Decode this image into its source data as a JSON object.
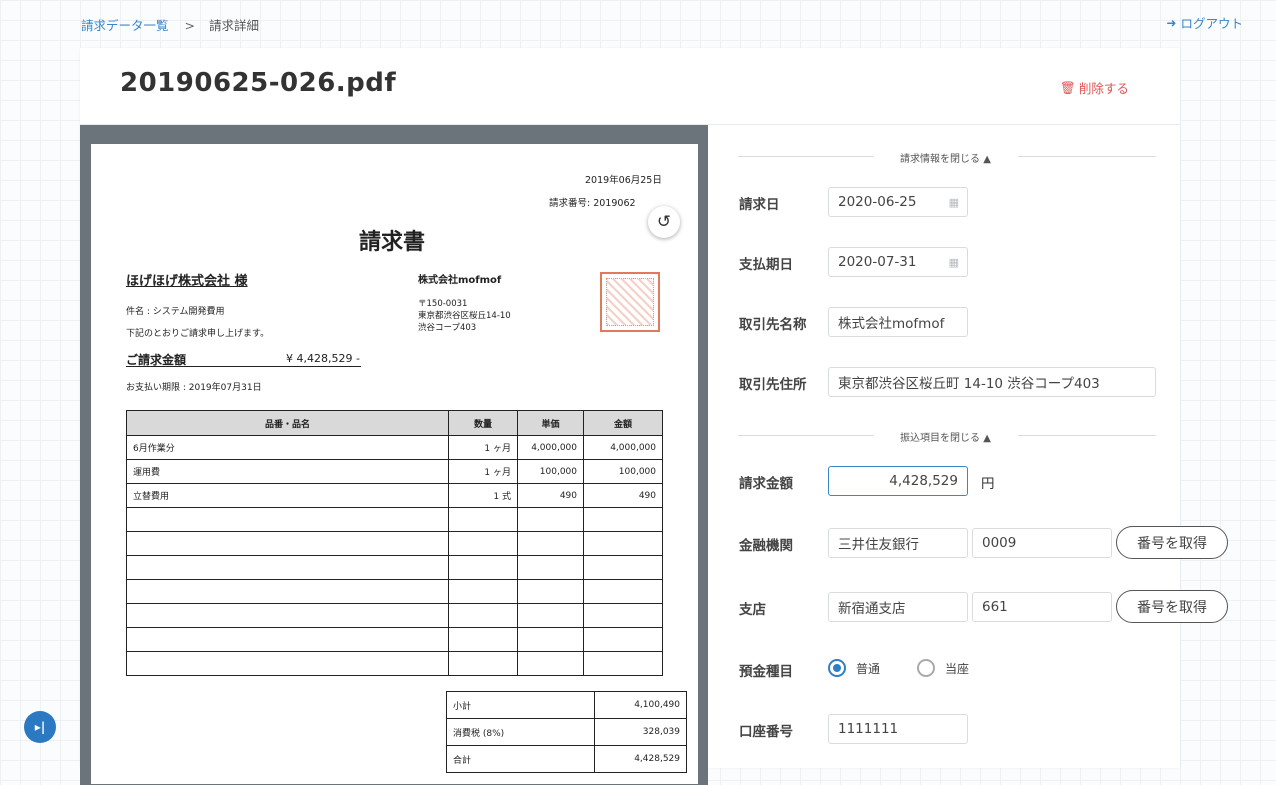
{
  "breadcrumb": {
    "home": "請求データ一覧",
    "separator": ">",
    "current": "請求詳細"
  },
  "header": {
    "logout_icon": "logout-icon",
    "logout_label": "ログアウト"
  },
  "card": {
    "file_title": "20190625-026.pdf",
    "delete_icon": "trash-icon",
    "delete_label": "削除する"
  },
  "document": {
    "date": "2019年06月25日",
    "invoice_no": "請求番号: 2019062",
    "title": "請求書",
    "client": "ほげほげ株式会社 様",
    "subject": "件名 : システム開発費用",
    "note": "下記のとおりご請求申し上げます。",
    "amount_label": "ご請求金額",
    "amount_value": "¥ 4,428,529 -",
    "due": "お支払い期限 : 2019年07月31日",
    "issuer": "株式会社mofmof",
    "postal": "〒150-0031",
    "address1": "東京都渋谷区桜丘14-10",
    "address2": "渋谷コープ403",
    "columns": [
      "品番・品名",
      "数量",
      "単価",
      "金額"
    ],
    "rows": [
      [
        "6月作業分",
        "1 ヶ月",
        "4,000,000",
        "4,000,000"
      ],
      [
        "運用費",
        "1 ヶ月",
        "100,000",
        "100,000"
      ],
      [
        "立替費用",
        "1 式",
        "490",
        "490"
      ],
      [
        "",
        "",
        "",
        ""
      ],
      [
        "",
        "",
        "",
        ""
      ],
      [
        "",
        "",
        "",
        ""
      ],
      [
        "",
        "",
        "",
        ""
      ],
      [
        "",
        "",
        "",
        ""
      ],
      [
        "",
        "",
        "",
        ""
      ],
      [
        "",
        "",
        "",
        ""
      ]
    ],
    "summary": [
      [
        "小計",
        "4,100,490"
      ],
      [
        "消費税 (8%)",
        "328,039"
      ],
      [
        "合計",
        "4,428,529"
      ]
    ]
  },
  "form": {
    "billing_section": "請求情報を閉じる",
    "invoice_date_label": "請求日",
    "invoice_date": "2020-06-25",
    "due_date_label": "支払期日",
    "due_date": "2020-07-31",
    "partner_name_label": "取引先名称",
    "partner_name": "株式会社mofmof",
    "partner_address_label": "取引先住所",
    "partner_address": "東京都渋谷区桜丘町 14-10 渋谷コープ403",
    "transfer_section": "振込項目を閉じる",
    "amount_label": "請求金額",
    "amount": "4,428,529",
    "amount_unit": "円",
    "bank_label": "金融機関",
    "bank_name": "三井住友銀行",
    "bank_code": "0009",
    "fetch_number": "番号を取得",
    "branch_label": "支店",
    "branch_name": "新宿通支店",
    "branch_code": "661",
    "account_type_label": "預金種目",
    "account_type_options": [
      "普通",
      "当座"
    ],
    "account_type_selected": "普通",
    "account_number_label": "口座番号",
    "account_number": "1111111"
  }
}
